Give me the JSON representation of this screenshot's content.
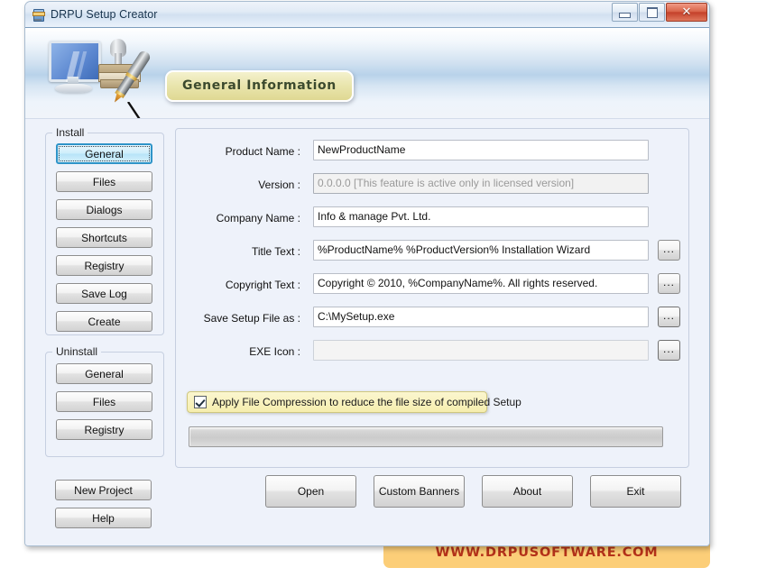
{
  "window": {
    "title": "DRPU Setup Creator",
    "icon": "setup-creator-icon",
    "buttons": {
      "minimize": "minimize-icon",
      "maximize": "maximize-icon",
      "close": "✕"
    }
  },
  "header": {
    "badge_label": "General Information",
    "art": "monitor-stamp-pen-illustration"
  },
  "sidebar": {
    "install": {
      "title": "Install",
      "items": [
        {
          "label": "General",
          "selected": true
        },
        {
          "label": "Files",
          "selected": false
        },
        {
          "label": "Dialogs",
          "selected": false
        },
        {
          "label": "Shortcuts",
          "selected": false
        },
        {
          "label": "Registry",
          "selected": false
        },
        {
          "label": "Save Log",
          "selected": false
        },
        {
          "label": "Create",
          "selected": false
        }
      ]
    },
    "uninstall": {
      "title": "Uninstall",
      "items": [
        {
          "label": "General"
        },
        {
          "label": "Files"
        },
        {
          "label": "Registry"
        }
      ]
    },
    "extra": [
      {
        "label": "New Project"
      },
      {
        "label": "Help"
      }
    ]
  },
  "form": {
    "fields": [
      {
        "label": "Product Name :",
        "value": "NewProductName",
        "placeholder": "",
        "disabled": false,
        "browse": false
      },
      {
        "label": "Version :",
        "value": "0.0.0.0 [This feature is active only in licensed version]",
        "placeholder": "",
        "disabled": true,
        "browse": false
      },
      {
        "label": "Company Name :",
        "value": "Info & manage Pvt. Ltd.",
        "placeholder": "",
        "disabled": false,
        "browse": false
      },
      {
        "label": "Title Text :",
        "value": "%ProductName% %ProductVersion% Installation Wizard",
        "placeholder": "",
        "disabled": false,
        "browse": true,
        "browse_label": "..."
      },
      {
        "label": "Copyright Text :",
        "value": "Copyright © 2010, %CompanyName%. All rights reserved.",
        "placeholder": "",
        "disabled": false,
        "browse": true,
        "browse_label": "..."
      },
      {
        "label": "Save Setup File as :",
        "value": "C:\\MySetup.exe",
        "placeholder": "",
        "disabled": false,
        "browse": true,
        "browse_label": "..."
      },
      {
        "label": "EXE Icon :",
        "value": "",
        "placeholder": "",
        "disabled": false,
        "blank": true,
        "browse": true,
        "browse_label": "..."
      }
    ],
    "compression": {
      "label": "Apply File Compression to reduce the file size of compiled Setup",
      "checked": true
    },
    "progress": {
      "value": 0
    }
  },
  "actions": [
    {
      "label": "Open"
    },
    {
      "label": "Custom Banners"
    },
    {
      "label": "About"
    },
    {
      "label": "Exit"
    }
  ],
  "branding": {
    "url": "WWW.DRPUSOFTWARE.COM"
  },
  "colors": {
    "accent_blue": "#2f94c8",
    "badge_yellow": "#e9e5ad",
    "highlight_yellow": "#f6eeae",
    "banner_orange": "#fcce78",
    "banner_text_red": "#b5321a",
    "panel_bg": "#eef2fa"
  }
}
